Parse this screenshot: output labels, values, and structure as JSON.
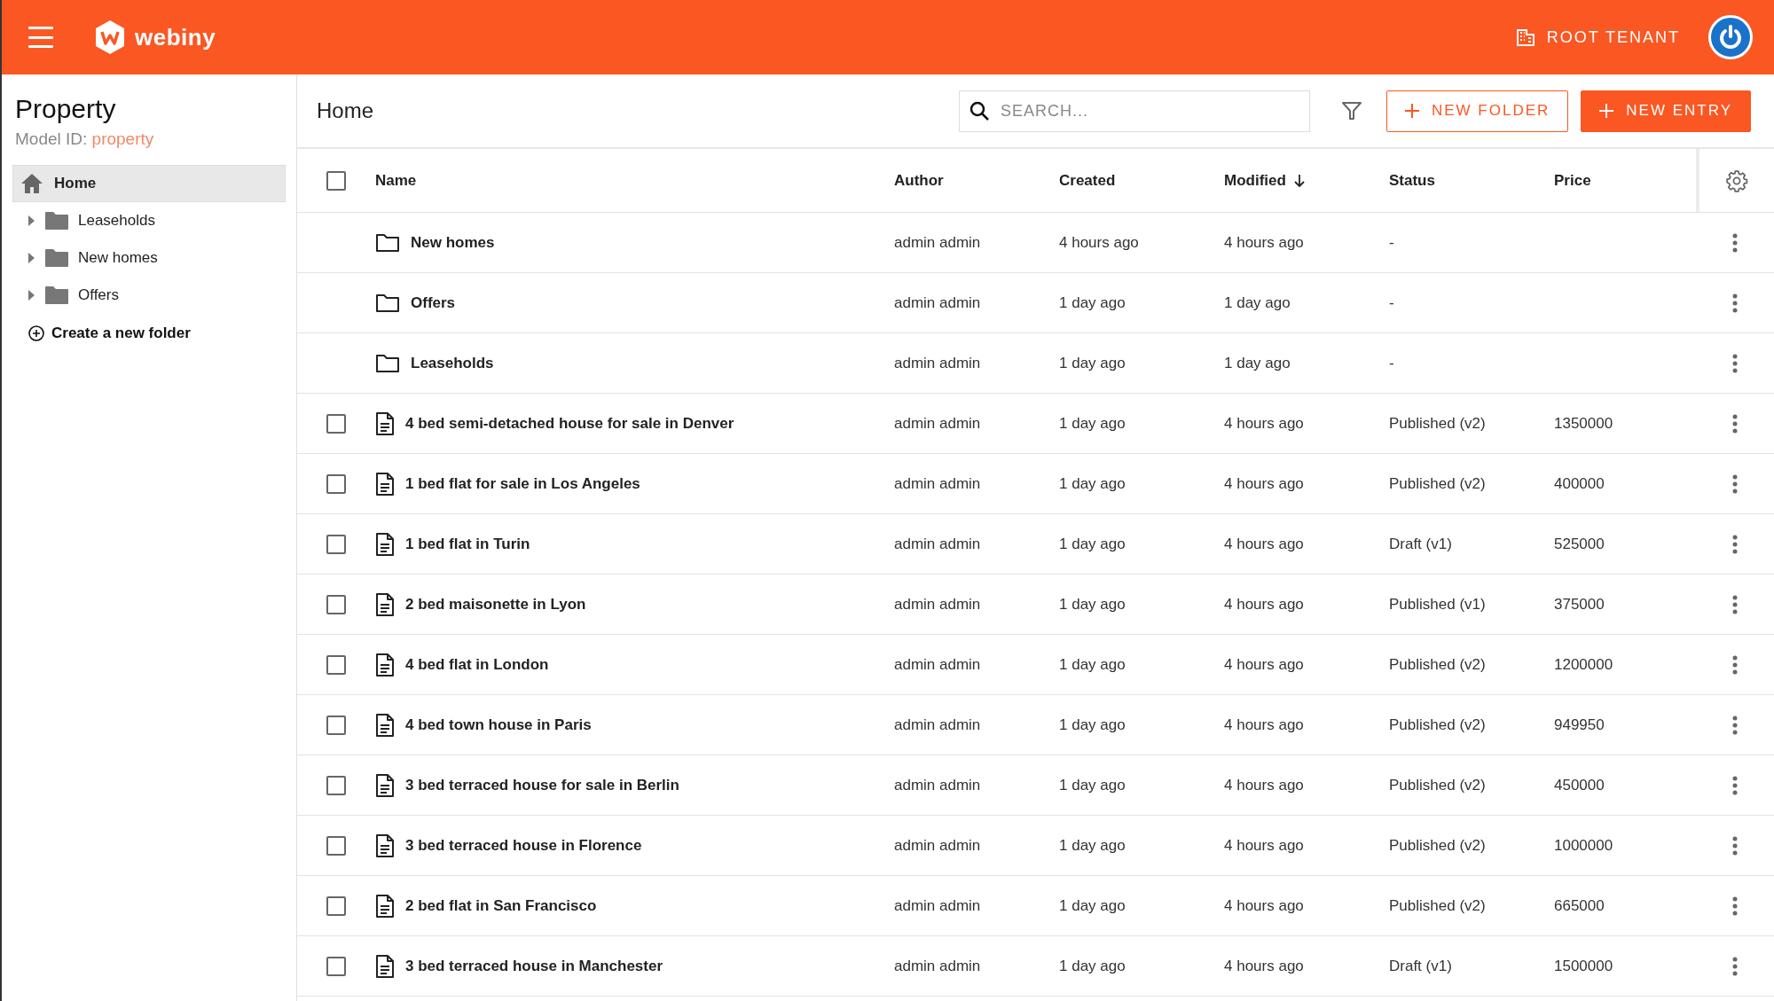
{
  "header": {
    "logo_text": "webiny",
    "tenant": "ROOT TENANT"
  },
  "sidebar": {
    "title": "Property",
    "model_id_label": "Model ID:",
    "model_id": "property",
    "home": {
      "label": "Home",
      "selected": true
    },
    "folders": [
      {
        "label": "Leaseholds",
        "expanded": false,
        "selected": false
      },
      {
        "label": "New homes",
        "expanded": false,
        "selected": false
      },
      {
        "label": "Offers",
        "expanded": false,
        "selected": false
      }
    ],
    "create_folder": "Create a new folder"
  },
  "toolbar": {
    "title": "Home",
    "search": {
      "placeholder": "SEARCH..."
    },
    "buttons": [
      {
        "label": "NEW FOLDER",
        "kind": "outlined"
      },
      {
        "label": "NEW ENTRY",
        "kind": "filled"
      }
    ]
  },
  "table": {
    "select_all": {
      "checked": false
    },
    "columns": [
      {
        "label": "Name",
        "sorted_desc": false
      },
      {
        "label": "Author",
        "sorted_desc": false
      },
      {
        "label": "Created",
        "sorted_desc": false
      },
      {
        "label": "Modified",
        "sorted_desc": true
      },
      {
        "label": "Status",
        "sorted_desc": false
      },
      {
        "label": "Price",
        "sorted_desc": false
      }
    ],
    "rows": [
      {
        "kind": "folder",
        "name": "New homes",
        "author": "admin admin",
        "created": "4 hours ago",
        "modified": "4 hours ago",
        "status": "-"
      },
      {
        "kind": "folder",
        "name": "Offers",
        "author": "admin admin",
        "created": "1 day ago",
        "modified": "1 day ago",
        "status": "-"
      },
      {
        "kind": "folder",
        "name": "Leaseholds",
        "author": "admin admin",
        "created": "1 day ago",
        "modified": "1 day ago",
        "status": "-"
      },
      {
        "kind": "entry",
        "checked": false,
        "name": "4 bed semi-detached house for sale in Denver",
        "author": "admin admin",
        "created": "1 day ago",
        "modified": "4 hours ago",
        "status": "Published (v2)",
        "price": "1350000"
      },
      {
        "kind": "entry",
        "checked": false,
        "name": "1 bed flat for sale in Los Angeles",
        "author": "admin admin",
        "created": "1 day ago",
        "modified": "4 hours ago",
        "status": "Published (v2)",
        "price": "400000"
      },
      {
        "kind": "entry",
        "checked": false,
        "name": "1 bed flat in Turin",
        "author": "admin admin",
        "created": "1 day ago",
        "modified": "4 hours ago",
        "status": "Draft (v1)",
        "price": "525000"
      },
      {
        "kind": "entry",
        "checked": false,
        "name": "2 bed maisonette in Lyon",
        "author": "admin admin",
        "created": "1 day ago",
        "modified": "4 hours ago",
        "status": "Published (v1)",
        "price": "375000"
      },
      {
        "kind": "entry",
        "checked": false,
        "name": "4 bed flat in London",
        "author": "admin admin",
        "created": "1 day ago",
        "modified": "4 hours ago",
        "status": "Published (v2)",
        "price": "1200000"
      },
      {
        "kind": "entry",
        "checked": false,
        "name": "4 bed town house in Paris",
        "author": "admin admin",
        "created": "1 day ago",
        "modified": "4 hours ago",
        "status": "Published (v2)",
        "price": "949950"
      },
      {
        "kind": "entry",
        "checked": false,
        "name": "3 bed terraced house for sale in Berlin",
        "author": "admin admin",
        "created": "1 day ago",
        "modified": "4 hours ago",
        "status": "Published (v2)",
        "price": "450000"
      },
      {
        "kind": "entry",
        "checked": false,
        "name": "3 bed terraced house in Florence",
        "author": "admin admin",
        "created": "1 day ago",
        "modified": "4 hours ago",
        "status": "Published (v2)",
        "price": "1000000"
      },
      {
        "kind": "entry",
        "checked": false,
        "name": "2 bed flat in San Francisco",
        "author": "admin admin",
        "created": "1 day ago",
        "modified": "4 hours ago",
        "status": "Published (v2)",
        "price": "665000"
      },
      {
        "kind": "entry",
        "checked": false,
        "name": "3 bed terraced house in Manchester",
        "author": "admin admin",
        "created": "1 day ago",
        "modified": "4 hours ago",
        "status": "Draft (v1)",
        "price": "1500000"
      }
    ]
  }
}
